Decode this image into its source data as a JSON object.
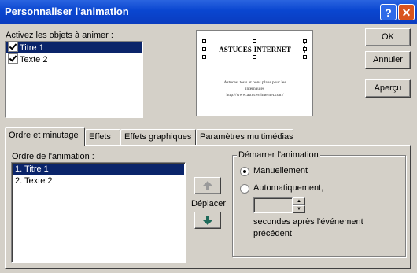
{
  "window": {
    "title": "Personnaliser l'animation"
  },
  "objects": {
    "label": "Activez les objets à animer :",
    "items": [
      {
        "label": "Titre 1",
        "checked": true,
        "selected": true
      },
      {
        "label": "Texte 2",
        "checked": true,
        "selected": false
      }
    ]
  },
  "preview": {
    "title": "ASTUCES-INTERNET",
    "body_line1": "Astuces, tests et bons plans pour les",
    "body_line2": "internautes",
    "body_line3": "http://www.astuces-internet.com/"
  },
  "buttons": {
    "ok": "OK",
    "cancel": "Annuler",
    "preview": "Aperçu"
  },
  "tabs": [
    {
      "label": "Ordre et minutage",
      "active": true
    },
    {
      "label": "Effets",
      "active": false
    },
    {
      "label": "Effets graphiques",
      "active": false
    },
    {
      "label": "Paramètres multimédias",
      "active": false
    }
  ],
  "order": {
    "label": "Ordre de l'animation :",
    "items": [
      {
        "label": "1. Titre 1",
        "selected": true
      },
      {
        "label": "2. Texte 2",
        "selected": false
      }
    ],
    "move_label": "Déplacer"
  },
  "start": {
    "legend": "Démarrer l'animation",
    "manual": "Manuellement",
    "auto": "Automatiquement,",
    "seconds_line1": "secondes après l'événement",
    "seconds_line2": "précédent",
    "seconds_value": ""
  },
  "colors": {
    "titlebar": "#0a46d0",
    "selection": "#0a246a",
    "dialog_bg": "#d4d0c8",
    "move_up_arrow": "#9a9a9a",
    "move_down_arrow": "#1e6a5a"
  }
}
